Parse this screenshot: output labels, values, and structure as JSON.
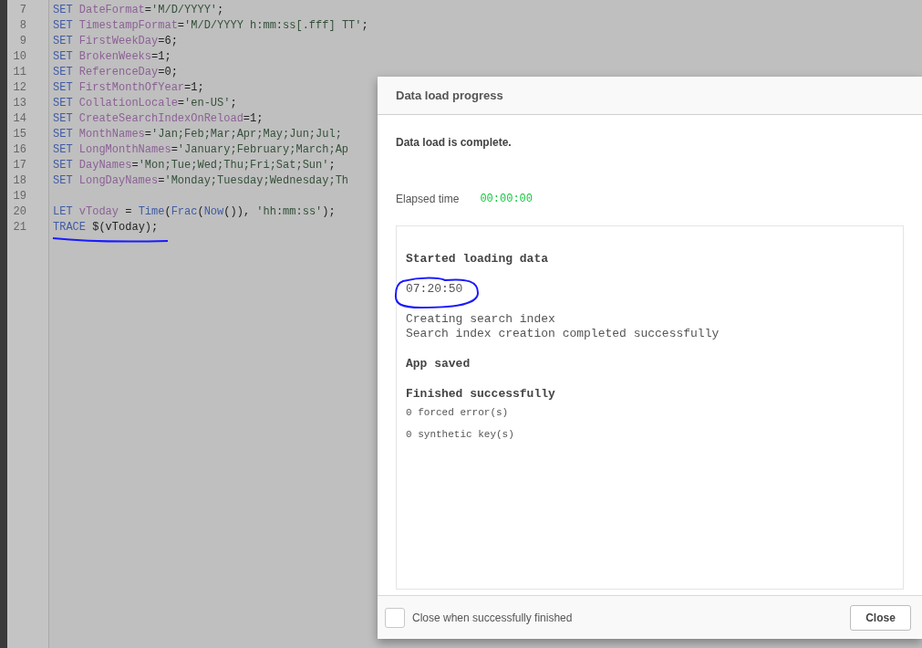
{
  "editor": {
    "lines": [
      {
        "number": "7",
        "tokens": [
          {
            "kind": "keyword",
            "text": "SET "
          },
          {
            "kind": "variable",
            "text": "DateFormat"
          },
          {
            "kind": "plain",
            "text": "="
          },
          {
            "kind": "string",
            "text": "'M/D/YYYY'"
          },
          {
            "kind": "plain",
            "text": ";"
          }
        ]
      },
      {
        "number": "8",
        "tokens": [
          {
            "kind": "keyword",
            "text": "SET "
          },
          {
            "kind": "variable",
            "text": "TimestampFormat"
          },
          {
            "kind": "plain",
            "text": "="
          },
          {
            "kind": "string",
            "text": "'M/D/YYYY h:mm:ss[.fff] TT'"
          },
          {
            "kind": "plain",
            "text": ";"
          }
        ]
      },
      {
        "number": "9",
        "tokens": [
          {
            "kind": "keyword",
            "text": "SET "
          },
          {
            "kind": "variable",
            "text": "FirstWeekDay"
          },
          {
            "kind": "plain",
            "text": "=6;"
          }
        ]
      },
      {
        "number": "10",
        "tokens": [
          {
            "kind": "keyword",
            "text": "SET "
          },
          {
            "kind": "variable",
            "text": "BrokenWeeks"
          },
          {
            "kind": "plain",
            "text": "=1;"
          }
        ]
      },
      {
        "number": "11",
        "tokens": [
          {
            "kind": "keyword",
            "text": "SET "
          },
          {
            "kind": "variable",
            "text": "ReferenceDay"
          },
          {
            "kind": "plain",
            "text": "=0;"
          }
        ]
      },
      {
        "number": "12",
        "tokens": [
          {
            "kind": "keyword",
            "text": "SET "
          },
          {
            "kind": "variable",
            "text": "FirstMonthOfYear"
          },
          {
            "kind": "plain",
            "text": "=1;"
          }
        ]
      },
      {
        "number": "13",
        "tokens": [
          {
            "kind": "keyword",
            "text": "SET "
          },
          {
            "kind": "variable",
            "text": "CollationLocale"
          },
          {
            "kind": "plain",
            "text": "="
          },
          {
            "kind": "string",
            "text": "'en-US'"
          },
          {
            "kind": "plain",
            "text": ";"
          }
        ]
      },
      {
        "number": "14",
        "tokens": [
          {
            "kind": "keyword",
            "text": "SET "
          },
          {
            "kind": "variable",
            "text": "CreateSearchIndexOnReload"
          },
          {
            "kind": "plain",
            "text": "=1;"
          }
        ]
      },
      {
        "number": "15",
        "tokens": [
          {
            "kind": "keyword",
            "text": "SET "
          },
          {
            "kind": "variable",
            "text": "MonthNames"
          },
          {
            "kind": "plain",
            "text": "="
          },
          {
            "kind": "string",
            "text": "'Jan;Feb;Mar;Apr;May;Jun;Jul;"
          }
        ]
      },
      {
        "number": "16",
        "tokens": [
          {
            "kind": "keyword",
            "text": "SET "
          },
          {
            "kind": "variable",
            "text": "LongMonthNames"
          },
          {
            "kind": "plain",
            "text": "="
          },
          {
            "kind": "string",
            "text": "'January;February;March;Ap"
          }
        ]
      },
      {
        "number": "17",
        "tokens": [
          {
            "kind": "keyword",
            "text": "SET "
          },
          {
            "kind": "variable",
            "text": "DayNames"
          },
          {
            "kind": "plain",
            "text": "="
          },
          {
            "kind": "string",
            "text": "'Mon;Tue;Wed;Thu;Fri;Sat;Sun'"
          },
          {
            "kind": "plain",
            "text": ";"
          }
        ]
      },
      {
        "number": "18",
        "tokens": [
          {
            "kind": "keyword",
            "text": "SET "
          },
          {
            "kind": "variable",
            "text": "LongDayNames"
          },
          {
            "kind": "plain",
            "text": "="
          },
          {
            "kind": "string",
            "text": "'Monday;Tuesday;Wednesday;Th"
          }
        ]
      },
      {
        "number": "19"
      },
      {
        "number": "20",
        "tokens": [
          {
            "kind": "keyword",
            "text": "LET "
          },
          {
            "kind": "variable",
            "text": "vToday"
          },
          {
            "kind": "plain",
            "text": " = "
          },
          {
            "kind": "function",
            "text": "Time"
          },
          {
            "kind": "plain",
            "text": "("
          },
          {
            "kind": "function",
            "text": "Frac"
          },
          {
            "kind": "plain",
            "text": "("
          },
          {
            "kind": "function",
            "text": "Now"
          },
          {
            "kind": "plain",
            "text": "()), "
          },
          {
            "kind": "string",
            "text": "'hh:mm:ss'"
          },
          {
            "kind": "plain",
            "text": ");"
          }
        ]
      },
      {
        "number": "21",
        "tokens": [
          {
            "kind": "keyword",
            "text": "TRACE "
          },
          {
            "kind": "plain",
            "text": "$(vToday);"
          }
        ]
      }
    ]
  },
  "dialog": {
    "title": "Data load progress",
    "status": "Data load is complete.",
    "elapsed_label": "Elapsed time",
    "elapsed_value": "00:00:00",
    "log": [
      [
        {
          "kind": "heading",
          "text": "Started loading data"
        }
      ],
      [
        {
          "kind": "text",
          "text": "07:20:50"
        }
      ],
      [
        {
          "kind": "text",
          "text": "Creating search index"
        },
        {
          "kind": "text",
          "text": "Search index creation completed successfully"
        }
      ],
      [
        {
          "kind": "heading",
          "text": "App saved"
        }
      ],
      [
        {
          "kind": "heading",
          "text": "Finished successfully"
        },
        {
          "kind": "small",
          "text": "0 forced error(s)"
        },
        {
          "kind": "small",
          "text": "0 synthetic key(s)"
        }
      ]
    ],
    "close_when_finished": {
      "label": "Close when successfully finished",
      "checked": false
    },
    "close_button": "Close"
  }
}
